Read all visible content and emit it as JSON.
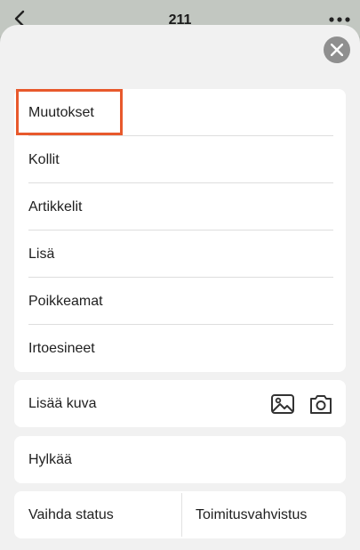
{
  "header": {
    "title": "211"
  },
  "menu": {
    "items": [
      {
        "label": "Muutokset",
        "highlighted": true
      },
      {
        "label": "Kollit"
      },
      {
        "label": "Artikkelit"
      },
      {
        "label": "Lisä"
      },
      {
        "label": "Poikkeamat"
      },
      {
        "label": "Irtoesineet"
      }
    ]
  },
  "photo": {
    "label": "Lisää kuva",
    "icons": [
      "image-gallery-icon",
      "camera-icon"
    ]
  },
  "reject": {
    "label": "Hylkää"
  },
  "bottom": {
    "change_status": "Vaihda status",
    "delivery_confirmation": "Toimitusvahvistus"
  },
  "colors": {
    "highlight": "#e8592c",
    "sheet": "#f1f1f1",
    "close": "#8f8f8f"
  }
}
